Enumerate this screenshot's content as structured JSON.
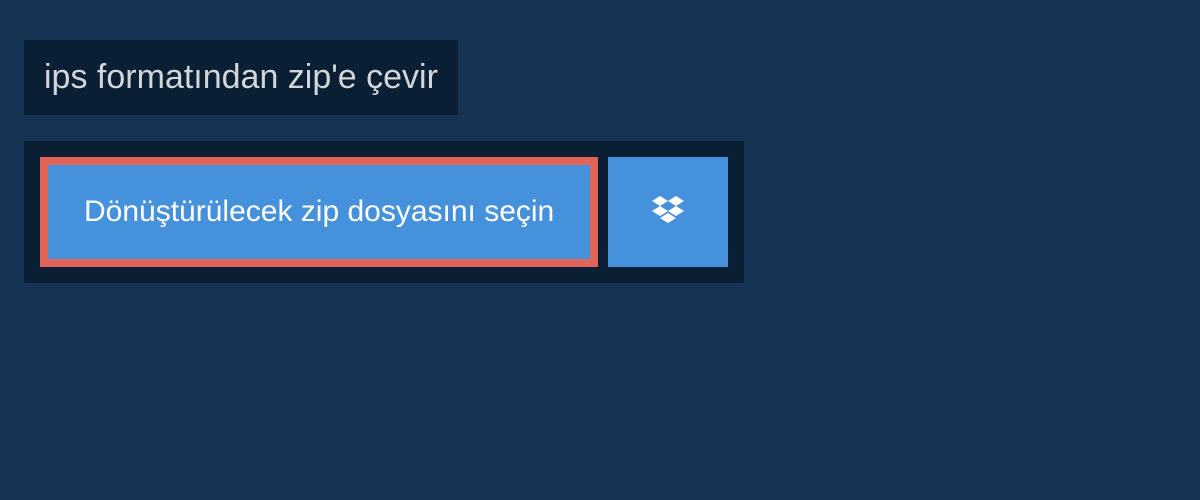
{
  "title": "ips formatından zip'e çevir",
  "main": {
    "select_button_label": "Dönüştürülecek zip dosyasını seçin"
  },
  "icons": {
    "dropbox": "dropbox-icon"
  },
  "colors": {
    "background": "#153352",
    "panel": "#0a1f33",
    "button": "#4691dc",
    "highlight_border": "#e16459"
  }
}
